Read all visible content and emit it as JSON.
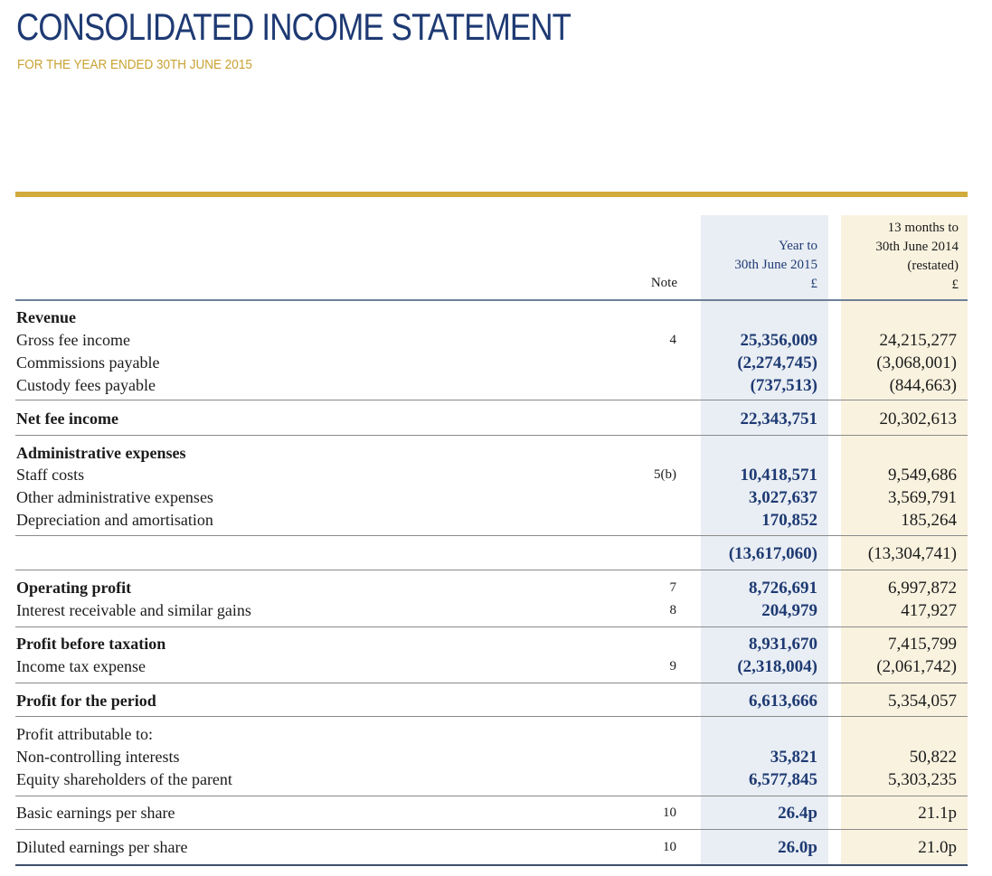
{
  "header": {
    "title": "CONSOLIDATED INCOME STATEMENT",
    "subtitle": "FOR THE YEAR ENDED 30TH JUNE 2015"
  },
  "columns": {
    "note": "Note",
    "current": [
      "Year to",
      "30th June 2015",
      "£"
    ],
    "prior": [
      "13 months to",
      "30th June 2014",
      "(restated)",
      "£"
    ]
  },
  "rows": [
    {
      "label": "Revenue",
      "note": "",
      "current": "",
      "prior": "",
      "bold": true
    },
    {
      "label": "Gross fee income",
      "note": "4",
      "current": "25,356,009",
      "prior": "24,215,277"
    },
    {
      "label": "Commissions payable",
      "note": "",
      "current": "(2,274,745)",
      "prior": "(3,068,001)"
    },
    {
      "label": "Custody fees payable",
      "note": "",
      "current": "(737,513)",
      "prior": "(844,663)"
    },
    {
      "label": "Net fee income",
      "note": "",
      "current": "22,343,751",
      "prior": "20,302,613",
      "bold": true
    },
    {
      "label": "Administrative expenses",
      "note": "",
      "current": "",
      "prior": "",
      "bold": true
    },
    {
      "label": "Staff costs",
      "note": "5(b)",
      "current": "10,418,571",
      "prior": "9,549,686"
    },
    {
      "label": "Other administrative expenses",
      "note": "",
      "current": "3,027,637",
      "prior": "3,569,791"
    },
    {
      "label": "Depreciation and amortisation",
      "note": "",
      "current": "170,852",
      "prior": "185,264"
    },
    {
      "label": "",
      "note": "",
      "current": "(13,617,060)",
      "prior": "(13,304,741)"
    },
    {
      "label": "Operating profit",
      "note": "7",
      "current": "8,726,691",
      "prior": "6,997,872",
      "bold": true
    },
    {
      "label": "Interest receivable and similar gains",
      "note": "8",
      "current": "204,979",
      "prior": "417,927"
    },
    {
      "label": "Profit before taxation",
      "note": "",
      "current": "8,931,670",
      "prior": "7,415,799",
      "bold": true
    },
    {
      "label": "Income tax expense",
      "note": "9",
      "current": "(2,318,004)",
      "prior": "(2,061,742)"
    },
    {
      "label": "Profit for the period",
      "note": "",
      "current": "6,613,666",
      "prior": "5,354,057",
      "bold": true
    },
    {
      "label": "Profit attributable to:",
      "note": "",
      "current": "",
      "prior": ""
    },
    {
      "label": "Non-controlling interests",
      "note": "",
      "current": "35,821",
      "prior": "50,822"
    },
    {
      "label": "Equity shareholders of the parent",
      "note": "",
      "current": "6,577,845",
      "prior": "5,303,235"
    },
    {
      "label": "Basic earnings per share",
      "note": "10",
      "current": "26.4p",
      "prior": "21.1p"
    },
    {
      "label": "Diluted earnings per share",
      "note": "10",
      "current": "26.0p",
      "prior": "21.0p"
    }
  ]
}
